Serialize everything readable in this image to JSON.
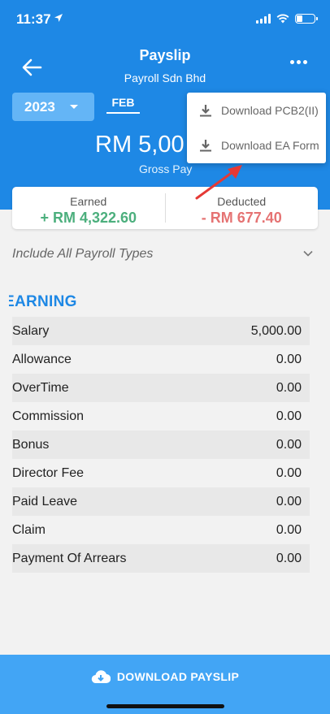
{
  "status_bar": {
    "time": "11:37",
    "battery_level": 0.35
  },
  "header": {
    "title": "Payslip",
    "subtitle": "Payroll Sdn Bhd",
    "year": "2023",
    "month": "FEB",
    "gross_amount": "RM 5,00",
    "gross_label": "Gross Pay"
  },
  "menu": {
    "items": [
      {
        "label": "Download PCB2(II)",
        "icon": "download-icon"
      },
      {
        "label": "Download EA Form",
        "icon": "download-icon"
      }
    ]
  },
  "summary": {
    "earned_label": "Earned",
    "earned_value": "+ RM 4,322.60",
    "deducted_label": "Deducted",
    "deducted_value": "- RM 677.40"
  },
  "filter": {
    "label": "Include All Payroll Types"
  },
  "earning": {
    "title": "EARNING",
    "rows": [
      {
        "name": "Salary",
        "amount": "5,000.00"
      },
      {
        "name": "Allowance",
        "amount": "0.00"
      },
      {
        "name": "OverTime",
        "amount": "0.00"
      },
      {
        "name": "Commission",
        "amount": "0.00"
      },
      {
        "name": "Bonus",
        "amount": "0.00"
      },
      {
        "name": "Director Fee",
        "amount": "0.00"
      },
      {
        "name": "Paid Leave",
        "amount": "0.00"
      },
      {
        "name": "Claim",
        "amount": "0.00"
      },
      {
        "name": "Payment Of Arrears",
        "amount": "0.00"
      }
    ]
  },
  "footer": {
    "download_label": "DOWNLOAD PAYSLIP"
  },
  "colors": {
    "primary": "#1e88e5",
    "earned": "#4caf7d",
    "deducted": "#e57373",
    "annotation": "#e53935"
  }
}
